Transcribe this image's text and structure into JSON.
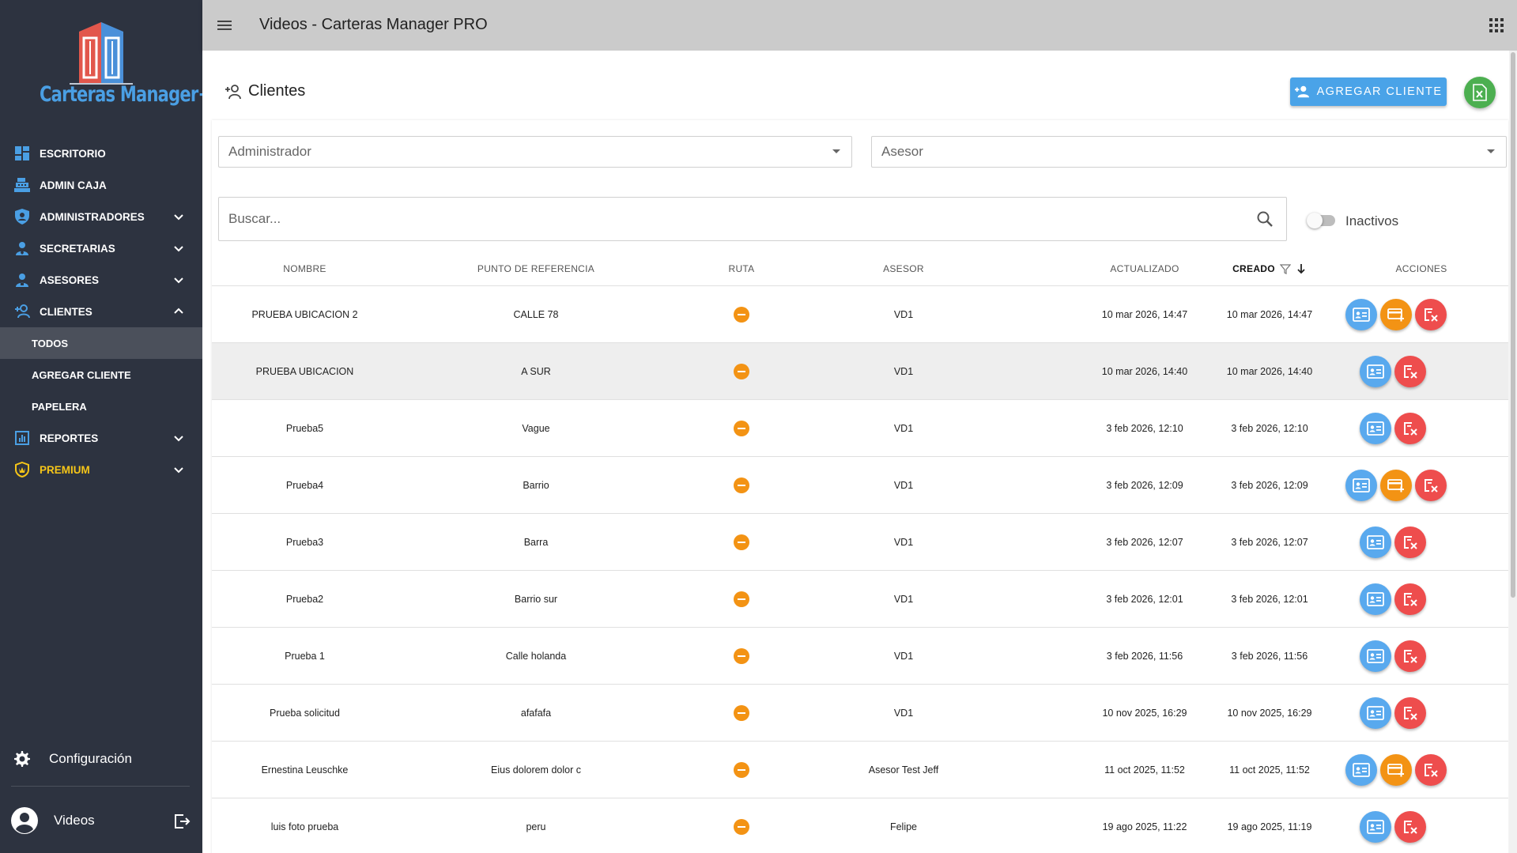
{
  "brand": {
    "logo_text": "Carteras Manager+"
  },
  "sidebar": {
    "items": [
      {
        "label": "ESCRITORIO",
        "icon": "dashboard-icon",
        "expandable": false
      },
      {
        "label": "ADMIN CAJA",
        "icon": "cash-register-icon",
        "expandable": false
      },
      {
        "label": "ADMINISTRADORES",
        "icon": "shield-user-icon",
        "expandable": true
      },
      {
        "label": "SECRETARIAS",
        "icon": "user-tie-icon",
        "expandable": true
      },
      {
        "label": "ASESORES",
        "icon": "users-icon",
        "expandable": true
      },
      {
        "label": "CLIENTES",
        "icon": "add-user-icon",
        "expandable": true,
        "expanded": true
      },
      {
        "label": "REPORTES",
        "icon": "bar-chart-icon",
        "expandable": true
      },
      {
        "label": "PREMIUM",
        "icon": "premium-badge-icon",
        "expandable": true
      }
    ],
    "subitems": [
      {
        "label": "TODOS",
        "active": true
      },
      {
        "label": "AGREGAR CLIENTE",
        "active": false
      },
      {
        "label": "PAPELERA",
        "active": false
      }
    ],
    "config_label": "Configuración",
    "user_name": "Videos"
  },
  "topbar": {
    "title": "Videos - Carteras Manager PRO"
  },
  "page": {
    "title": "Clientes",
    "add_button_label": "AGREGAR CLIENTE",
    "filters": {
      "administrador_placeholder": "Administrador",
      "asesor_placeholder": "Asesor"
    },
    "search_placeholder": "Buscar...",
    "inactivos_label": "Inactivos"
  },
  "colors": {
    "accent": "#4aa3e8",
    "sidebar": "#2d3340",
    "ruta": "#f39314",
    "edit": "#59a9ee",
    "payment": "#f39314",
    "delete": "#ee4d4d",
    "excel": "#4caf50"
  },
  "table": {
    "columns": [
      "NOMBRE",
      "PUNTO DE REFERENCIA",
      "RUTA",
      "ASESOR",
      "ACTUALIZADO",
      "CREADO",
      "ACCIONES"
    ],
    "rows": [
      {
        "nombre": "PRUEBA UBICACION 2",
        "referencia": "CALLE 78",
        "asesor": "VD1",
        "actualizado": "10 mar 2026, 14:47",
        "creado": "10 mar 2026, 14:47",
        "acciones": [
          "edit",
          "payment",
          "delete"
        ]
      },
      {
        "nombre": "PRUEBA UBICACION",
        "referencia": "A SUR",
        "asesor": "VD1",
        "actualizado": "10 mar 2026, 14:40",
        "creado": "10 mar 2026, 14:40",
        "acciones": [
          "edit",
          "delete"
        ]
      },
      {
        "nombre": "Prueba5",
        "referencia": "Vague",
        "asesor": "VD1",
        "actualizado": "3 feb 2026, 12:10",
        "creado": "3 feb 2026, 12:10",
        "acciones": [
          "edit",
          "delete"
        ]
      },
      {
        "nombre": "Prueba4",
        "referencia": "Barrio",
        "asesor": "VD1",
        "actualizado": "3 feb 2026, 12:09",
        "creado": "3 feb 2026, 12:09",
        "acciones": [
          "edit",
          "payment",
          "delete"
        ]
      },
      {
        "nombre": "Prueba3",
        "referencia": "Barra",
        "asesor": "VD1",
        "actualizado": "3 feb 2026, 12:07",
        "creado": "3 feb 2026, 12:07",
        "acciones": [
          "edit",
          "delete"
        ]
      },
      {
        "nombre": "Prueba2",
        "referencia": "Barrio sur",
        "asesor": "VD1",
        "actualizado": "3 feb 2026, 12:01",
        "creado": "3 feb 2026, 12:01",
        "acciones": [
          "edit",
          "delete"
        ]
      },
      {
        "nombre": "Prueba 1",
        "referencia": "Calle holanda",
        "asesor": "VD1",
        "actualizado": "3 feb 2026, 11:56",
        "creado": "3 feb 2026, 11:56",
        "acciones": [
          "edit",
          "delete"
        ]
      },
      {
        "nombre": "Prueba solicitud",
        "referencia": "afafafa",
        "asesor": "VD1",
        "actualizado": "10 nov 2025, 16:29",
        "creado": "10 nov 2025, 16:29",
        "acciones": [
          "edit",
          "delete"
        ]
      },
      {
        "nombre": "Ernestina Leuschke",
        "referencia": "Eius dolorem dolor c",
        "asesor": "Asesor Test Jeff",
        "actualizado": "11 oct 2025, 11:52",
        "creado": "11 oct 2025, 11:52",
        "acciones": [
          "edit",
          "payment",
          "delete"
        ]
      },
      {
        "nombre": "luis foto prueba",
        "referencia": "peru",
        "asesor": "Felipe",
        "actualizado": "19 ago 2025, 11:22",
        "creado": "19 ago 2025, 11:19",
        "acciones": [
          "edit",
          "delete"
        ]
      }
    ]
  }
}
